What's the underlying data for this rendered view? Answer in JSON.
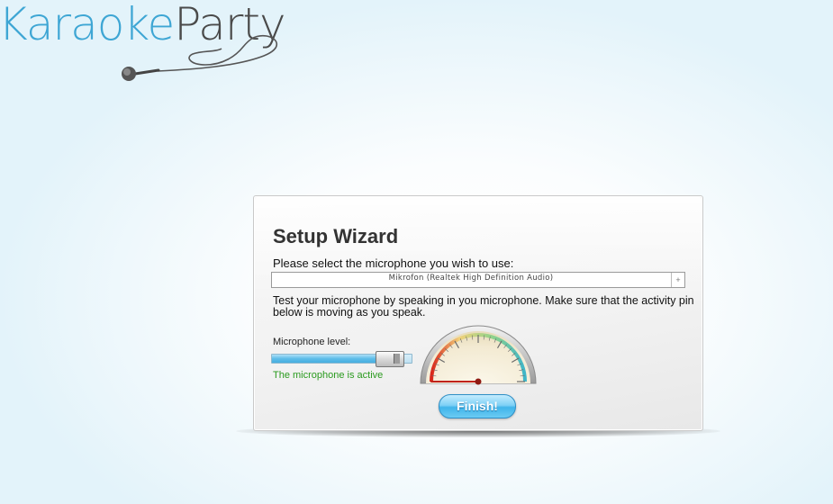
{
  "logo": {
    "part1": "Karaoke",
    "part2": "Party",
    "icon": "microphone-icon"
  },
  "wizard": {
    "title": "Setup Wizard",
    "select_label": "Please select the microphone you wish to use:",
    "microphone_select": {
      "value": "Mikrofon (Realtek High Definition Audio)",
      "button_icon": "+"
    },
    "instructions": "Test your microphone by speaking in you microphone. Make sure that the activity pin below is moving as you speak.",
    "level_label": "Microphone level:",
    "microphone_level": 0.92,
    "status": "The microphone is active",
    "finish_label": "Finish!"
  },
  "colors": {
    "logo_blue": "#3ea6d4",
    "logo_dark": "#4a4a4a",
    "status_green": "#2a9a1e",
    "button_blue": "#40b4ea"
  }
}
